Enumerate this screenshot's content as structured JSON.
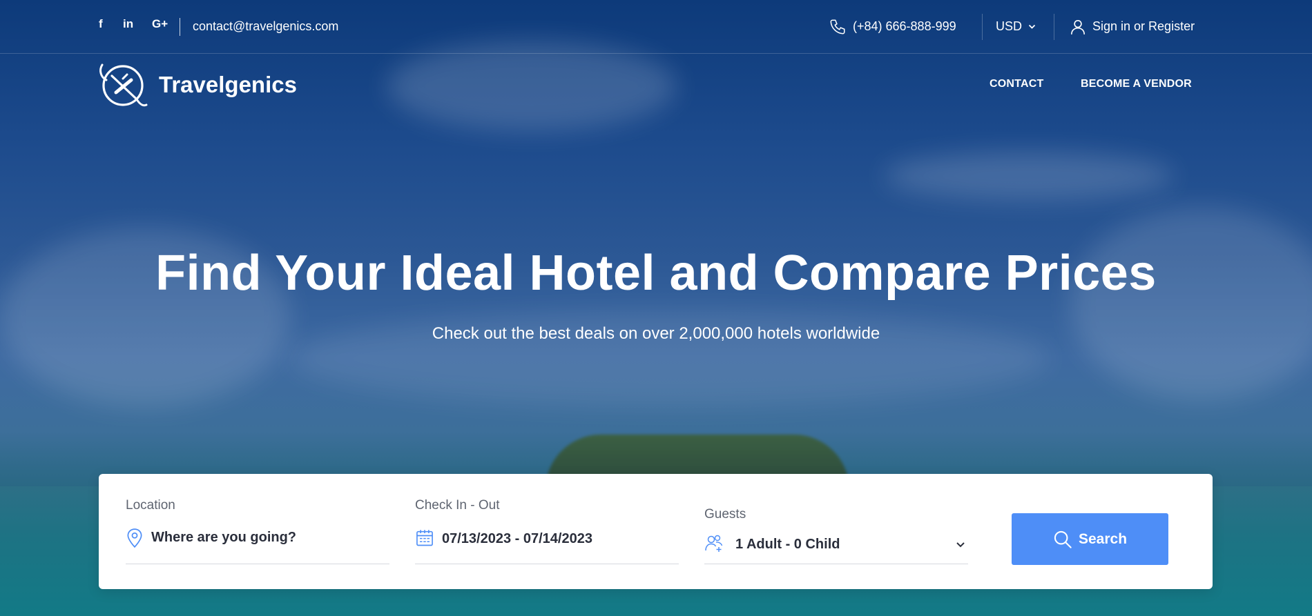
{
  "topbar": {
    "social": [
      "f",
      "in",
      "G+"
    ],
    "email": "contact@travelgenics.com",
    "phone": "(+84) 666-888-999",
    "currency": "USD",
    "account": "Sign in or Register"
  },
  "header": {
    "brand": "Travelgenics",
    "nav": [
      "CONTACT",
      "BECOME A VENDOR"
    ]
  },
  "hero": {
    "title": "Find Your Ideal Hotel and Compare Prices",
    "subtitle": "Check out the best deals on over 2,000,000 hotels worldwide"
  },
  "search": {
    "location_label": "Location",
    "location_placeholder": "Where are you going?",
    "dates_label": "Check In - Out",
    "dates_value": "07/13/2023 - 07/14/2023",
    "guests_label": "Guests",
    "guests_value": "1 Adult - 0 Child",
    "button": "Search"
  },
  "colors": {
    "accent": "#4e8ef7",
    "hero_top": "#0d3a7a",
    "text_dark": "#2a2e3b"
  },
  "icons": [
    "facebook-icon",
    "linkedin-icon",
    "google-plus-icon",
    "phone-icon",
    "chevron-down-icon",
    "user-icon",
    "logo-icon",
    "location-pin-icon",
    "calendar-icon",
    "guests-icon",
    "search-icon"
  ]
}
